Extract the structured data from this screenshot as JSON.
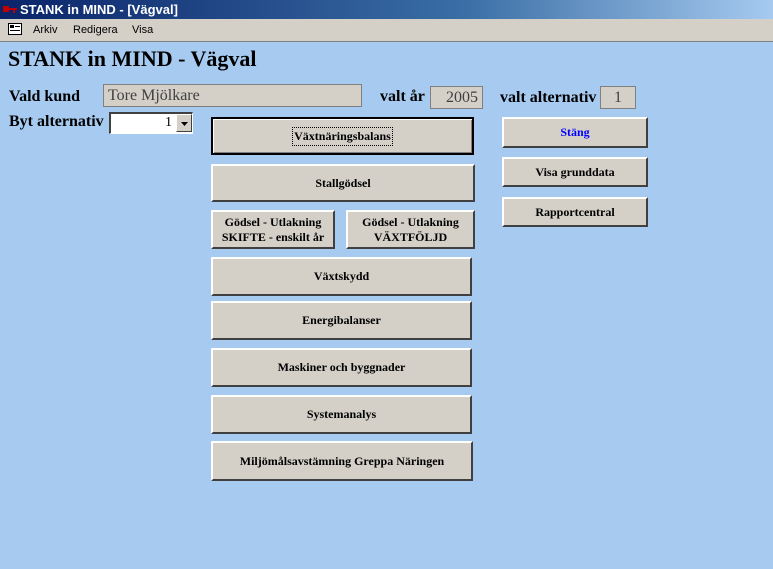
{
  "window": {
    "title": "STANK in MIND - [Vägval]"
  },
  "menu": {
    "items": [
      "Arkiv",
      "Redigera",
      "Visa"
    ]
  },
  "form": {
    "heading": "STANK in MIND - Vägval",
    "customer_label": "Vald kund",
    "customer_value": "Tore Mjölkare",
    "year_label": "valt år",
    "year_value": "2005",
    "alt_label": "valt alternativ",
    "alt_value": "1",
    "change_alt_label": "Byt alternativ",
    "change_alt_value": "1"
  },
  "buttons": {
    "vaxtnaring": "Växtnäringsbalans",
    "stallgodsel": "Stallgödsel",
    "godsel_skifte": "Gödsel - Utlakning SKIFTE - enskilt år",
    "godsel_vaxtfoljd": "Gödsel - Utlakning VÄXTFÖLJD",
    "vaxtskydd": "Växtskydd",
    "energi": "Energibalanser",
    "maskiner": "Maskiner och byggnader",
    "system": "Systemanalys",
    "miljo": "Miljömålsavstämning Greppa Näringen",
    "stang": "Stäng",
    "grunddata": "Visa grunddata",
    "rapport": "Rapportcentral"
  },
  "colors": {
    "form_background": "#a6caf0",
    "titlebar": "#0a246a",
    "close_text": "#0000ff"
  },
  "icons": {
    "app": "app-key-icon",
    "system": "form-system-icon",
    "dropdown": "chevron-down-icon"
  }
}
